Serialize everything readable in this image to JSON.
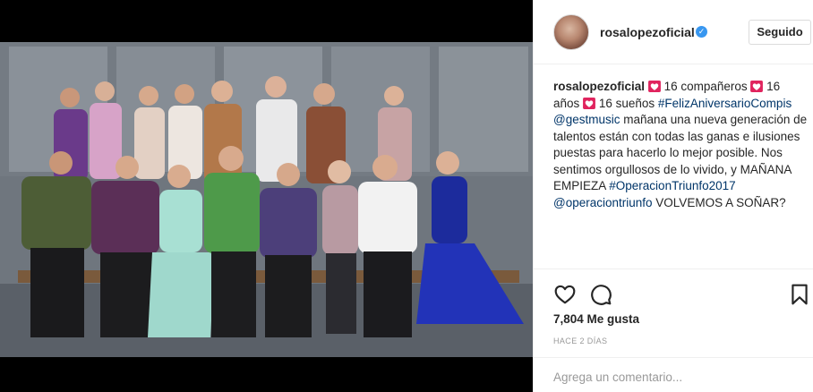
{
  "post": {
    "username": "rosalopezoficial",
    "follow_label": "Seguido",
    "caption_user": "rosalopezoficial",
    "caption_parts": {
      "p1": "16 compañeros",
      "p2": "16 años",
      "p3": "16 sueños",
      "tag1": "#FelizAniversarioCompis",
      "mention1": "@gestmusic",
      "body1": "mañana una nueva generación de talentos están con todas las ganas e ilusiones puestas para hacerlo lo mejor posible. Nos sentimos orgullosos de lo vivido, y MAÑANA EMPIEZA",
      "tag2": "#OperacionTriunfo2017",
      "mention2": "@operaciontriunfo",
      "body2": "VOLVEMOS A SOÑAR?"
    },
    "likes": "7,804 Me gusta",
    "time_ago": "HACE 2 DÍAS",
    "comment_placeholder": "Agrega un comentario..."
  },
  "icons": {
    "like": "heart-outline-icon",
    "comment": "speech-bubble-icon",
    "save": "bookmark-icon",
    "verified": "verified-badge-icon",
    "caption_emoji": "red-heart-emoji"
  },
  "colors": {
    "link": "#003569",
    "verified": "#3897f0",
    "emoji_heart": "#e0245e",
    "muted": "#999999"
  }
}
